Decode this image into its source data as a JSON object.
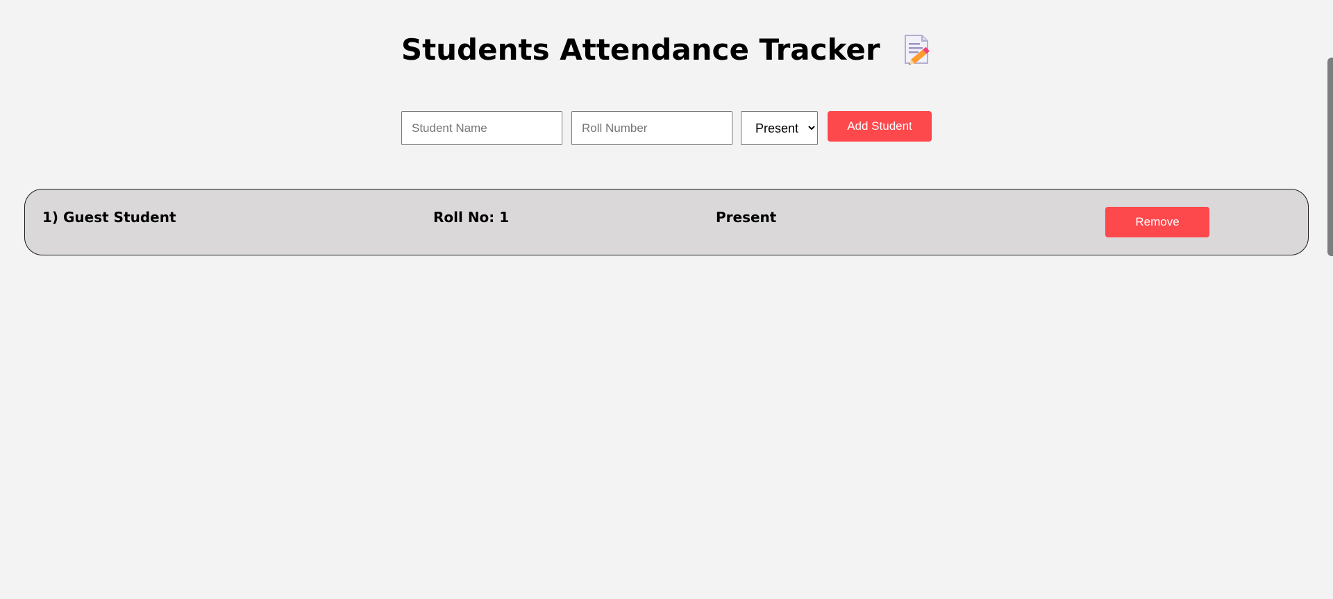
{
  "header": {
    "title": "Students Attendance Tracker",
    "title_icon": "memo-icon"
  },
  "form": {
    "name_placeholder": "Student Name",
    "name_value": "",
    "roll_placeholder": "Roll Number",
    "roll_value": "",
    "status_selected": "Present",
    "add_label": "Add Student"
  },
  "students": [
    {
      "name_text": "1) Guest Student",
      "roll_text": "Roll No: 1",
      "status_text": "Present",
      "remove_label": "Remove"
    }
  ],
  "colors": {
    "accent": "#fd484c",
    "background": "#f3f3f3",
    "row_background": "#dad8d9"
  }
}
